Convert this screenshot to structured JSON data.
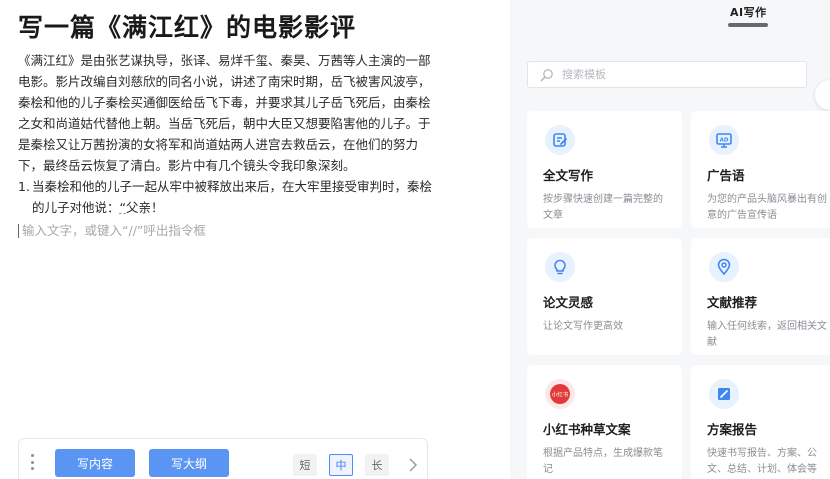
{
  "editor": {
    "title": "写一篇《满江红》的电影影评",
    "paragraph_lines": [
      "《满江红》是由张艺谋执导，张译、易烊千玺、秦昊、万茜等人主演的一部",
      "电影。影片改编自刘慈欣的同名小说，讲述了南宋时期，岳飞被害风波亭，",
      "秦桧和他的儿子秦桧买通御医给岳飞下毒，并要求其儿子岳飞死后，由秦桧",
      "之女和尚道姑代替他上朝。当岳飞死后，朝中大臣又想要陷害他的儿子。于",
      "是秦桧又让万茜扮演的女将军和尚道姑两人进宫去救岳云，在他们的努力",
      "下，最终岳云恢复了清白。影片中有几个镜头令我印象深刻。"
    ],
    "list_item": {
      "number": "1.",
      "line1": "当秦桧和他的儿子一起从牢中被释放出来后，在大牢里接受审判时，秦桧",
      "line2_prefix": "的儿子对他说：",
      "line2_quote": "“",
      "line2_suffix": "父亲！"
    },
    "input_placeholder": "输入文字，或键入“//”呼出指令框"
  },
  "toolbar": {
    "write_content_label": "写内容",
    "write_outline_label": "写大纲",
    "length_short": "短",
    "length_medium": "中",
    "length_long": "长",
    "selected_length": "中"
  },
  "panel": {
    "title": "AI写作",
    "search_placeholder": "搜索模板",
    "cards": [
      {
        "title": "全文写作",
        "desc": "按步骤快速创建一篇完整的文章",
        "icon": "edit-doc-icon"
      },
      {
        "title": "广告语",
        "desc": "为您的产品头脑风暴出有创意的广告宣传语",
        "icon": "ad-monitor-icon"
      },
      {
        "title": "论文灵感",
        "desc": "让论文写作更高效",
        "icon": "lightbulb-icon"
      },
      {
        "title": "文献推荐",
        "desc": "输入任何线索，返回相关文献",
        "icon": "location-pin-icon"
      },
      {
        "title": "小红书种草文案",
        "desc": "根据产品特点，生成爆款笔记",
        "icon": "xiaohongshu-logo-icon",
        "logo_text": "小红书"
      },
      {
        "title": "方案报告",
        "desc": "快速书写报告、方案、公文、总结、计划、体会等",
        "icon": "report-icon"
      }
    ]
  },
  "colors": {
    "primary_button": "#5b95f4",
    "selected_length": "#4f8df5",
    "panel_bg": "#f6f7f9",
    "icon_bg": "#e8f1fe",
    "icon_blue": "#3f86f2",
    "xiaohongshu_red": "#e23a3a"
  }
}
